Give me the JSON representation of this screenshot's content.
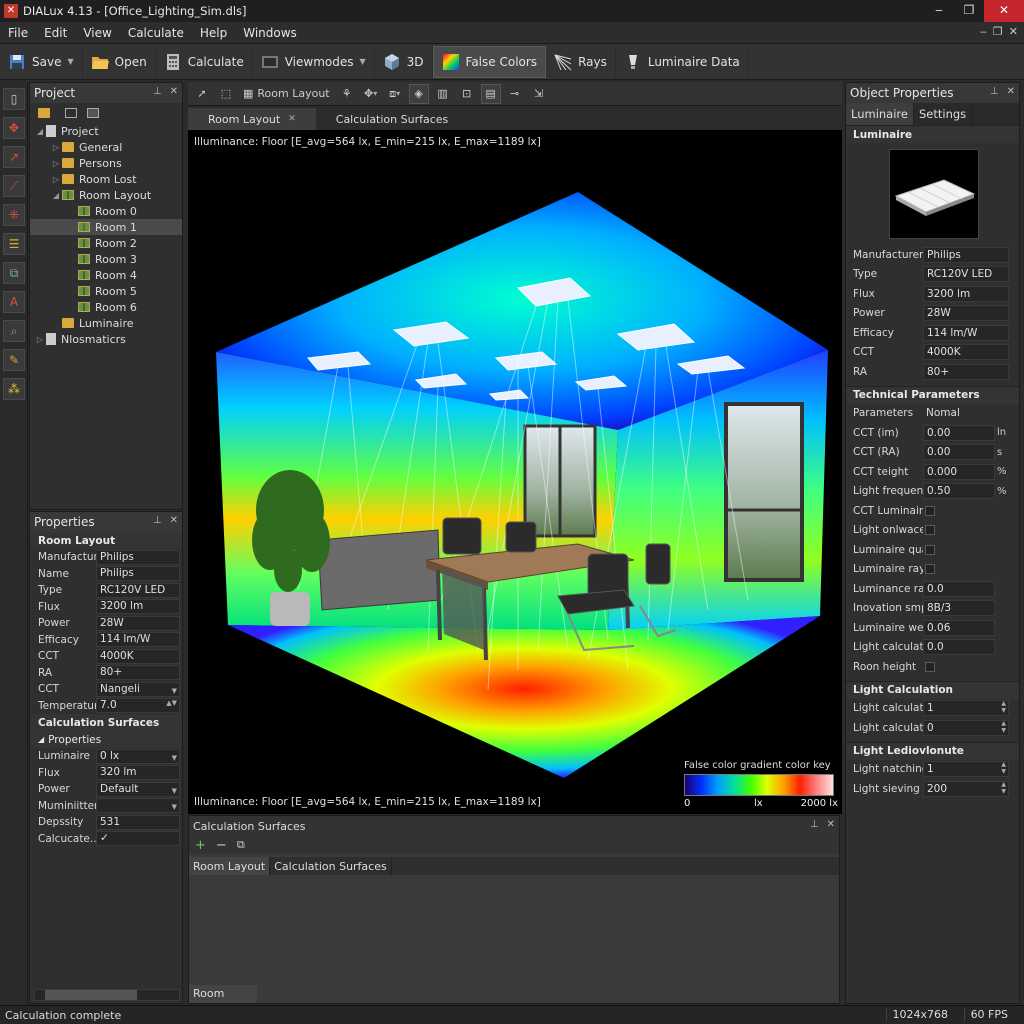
{
  "window": {
    "title": "DIALux 4.13 - [Office_Lighting_Sim.dls]",
    "min": "‒",
    "max": "❐",
    "close": "✕"
  },
  "menu": [
    "File",
    "Edit",
    "View",
    "Calculate",
    "Help",
    "Windows"
  ],
  "toolbar": {
    "save": "Save",
    "open": "Open",
    "calculate": "Calculate",
    "viewmodes": "Viewmodes",
    "three_d": "3D",
    "false_colors": "False Colors",
    "rays": "Rays",
    "luminaire_data": "Luminaire Data"
  },
  "project": {
    "title": "Project",
    "tree": [
      {
        "label": "Project",
        "level": 0,
        "icon": "doc",
        "twisty": "◢"
      },
      {
        "label": "General",
        "level": 1,
        "icon": "folder",
        "twisty": "▷"
      },
      {
        "label": "Persons",
        "level": 1,
        "icon": "folder",
        "twisty": "▷"
      },
      {
        "label": "Room Lost",
        "level": 1,
        "icon": "folder",
        "twisty": "▷"
      },
      {
        "label": "Room Layout",
        "level": 1,
        "icon": "grid",
        "twisty": "◢"
      },
      {
        "label": "Room 0",
        "level": 2,
        "icon": "grid",
        "twisty": ""
      },
      {
        "label": "Room 1",
        "level": 2,
        "icon": "grid",
        "twisty": "",
        "selected": true
      },
      {
        "label": "Room 2",
        "level": 2,
        "icon": "grid",
        "twisty": ""
      },
      {
        "label": "Room 3",
        "level": 2,
        "icon": "grid",
        "twisty": ""
      },
      {
        "label": "Room 4",
        "level": 2,
        "icon": "grid",
        "twisty": ""
      },
      {
        "label": "Room 5",
        "level": 2,
        "icon": "grid",
        "twisty": ""
      },
      {
        "label": "Room 6",
        "level": 2,
        "icon": "grid",
        "twisty": ""
      },
      {
        "label": "Luminaire",
        "level": 1,
        "icon": "folder",
        "twisty": ""
      },
      {
        "label": "Nlosmaticrs",
        "level": 0,
        "icon": "doc",
        "twisty": "▷"
      }
    ]
  },
  "properties": {
    "title": "Properties",
    "section1": "Room Layout",
    "rows": [
      {
        "label": "Manufacturer",
        "value": "Philips"
      },
      {
        "label": "Name",
        "value": "Philips"
      },
      {
        "label": "Type",
        "value": "RC120V LED"
      },
      {
        "label": "Flux",
        "value": "3200 lm"
      },
      {
        "label": "Power",
        "value": "28W"
      },
      {
        "label": "Efficacy",
        "value": "114 lm/W"
      },
      {
        "label": "CCT",
        "value": "4000K"
      },
      {
        "label": "RA",
        "value": "80+"
      },
      {
        "label": "CCT",
        "value": "Nangeli",
        "dropdown": true
      },
      {
        "label": "Temperature",
        "value": "7.0",
        "spinner": true
      }
    ],
    "section2": "Calculation Surfaces",
    "section3": "Properties",
    "rows2": [
      {
        "label": "Luminaire",
        "value": "0 lx",
        "dropdown": true
      },
      {
        "label": "Flux",
        "value": "320 lm"
      },
      {
        "label": "Power",
        "value": "Default",
        "dropdown": true
      },
      {
        "label": "Muminiitter",
        "value": "",
        "dropdown": true
      },
      {
        "label": "Depssity",
        "value": "531"
      },
      {
        "label": "Calcucate...",
        "value": "✓",
        "check": true
      }
    ]
  },
  "viewport": {
    "toolbar_label": "Room Layout",
    "tabs": [
      "Room Layout",
      "Calculation Surfaces"
    ],
    "illum_top": "Illuminance: Floor [E_avg=564 lx, E_min=215 lx, E_max=1189 lx]",
    "illum_bottom": "Illuminance: Floor [E_avg=564 lx, E_min=215 lx, E_max=1189 lx]",
    "colorkey_title": "False color gradient color key",
    "colorkey_min": "0",
    "colorkey_unit": "lx",
    "colorkey_max": "2000 lx"
  },
  "calc_panel": {
    "title": "Calculation Surfaces",
    "tools": [
      "+",
      "−",
      "⧉"
    ],
    "tabs": [
      "Room Layout",
      "Calculation Surfaces"
    ],
    "bottom_tab": "Room Layout"
  },
  "object_props": {
    "title": "Object Properties",
    "tabs": [
      "Luminaire",
      "Settings"
    ],
    "section_luminaire": "Luminaire",
    "rows": [
      {
        "label": "Manufacturer",
        "value": "Philips"
      },
      {
        "label": "Type",
        "value": "RC120V LED"
      },
      {
        "label": "Flux",
        "value": "3200 lm"
      },
      {
        "label": "Power",
        "value": "28W"
      },
      {
        "label": "Efficacy",
        "value": "114 lm/W"
      },
      {
        "label": "CCT",
        "value": "4000K"
      },
      {
        "label": "RA",
        "value": "80+"
      }
    ],
    "section_tech": "Technical Parameters",
    "tech_header": {
      "label": "Parameters",
      "value": "Nomal"
    },
    "tech_rows": [
      {
        "label": "CCT (im)",
        "value": "0.00",
        "unit": "ln"
      },
      {
        "label": "CCT (RA)",
        "value": "0.00",
        "unit": "s"
      },
      {
        "label": "CCT teight",
        "value": "0.000",
        "unit": "%"
      },
      {
        "label": "Light frequenc...",
        "value": "0.50",
        "unit": "%"
      },
      {
        "label": "CCT Luminaire...",
        "check": true
      },
      {
        "label": "Light onlwace...",
        "check": true
      },
      {
        "label": "Luminaire qua...",
        "check": true
      },
      {
        "label": "Luminaire rays...",
        "check": true
      },
      {
        "label": "Luminance ral...",
        "value": "0.0",
        "unit": ""
      },
      {
        "label": "Inovation smp...",
        "value": "8B/3",
        "unit": ""
      },
      {
        "label": "Luminaire wen...",
        "value": "0.06",
        "unit": ""
      },
      {
        "label": "Light calculatio...",
        "value": "0.0",
        "unit": ""
      },
      {
        "label": "Roon height",
        "check": true
      }
    ],
    "section_calc": "Light Calculation",
    "calc_rows": [
      {
        "label": "Light calculation",
        "value": "1"
      },
      {
        "label": "Light calculation",
        "value": "0"
      }
    ],
    "section_ledio": "Light Lediovlonute",
    "ledio_rows": [
      {
        "label": "Light natching",
        "value": "1"
      },
      {
        "label": "Light sieving",
        "value": "200"
      }
    ]
  },
  "status": {
    "text": "Calculation complete",
    "resolution": "1024x768",
    "fps": "60 FPS"
  }
}
